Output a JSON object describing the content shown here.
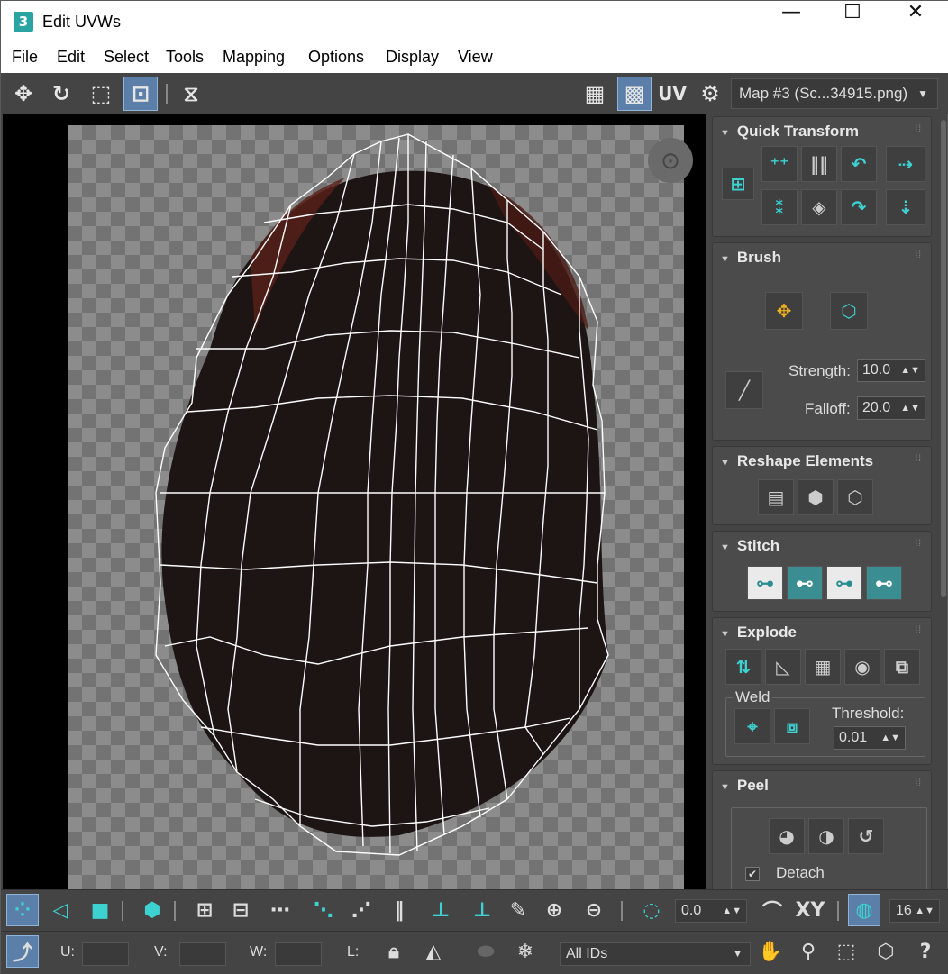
{
  "window": {
    "app_icon_text": "3",
    "title": "Edit UVWs",
    "minimize": "—",
    "maximize": "☐",
    "close": "✕"
  },
  "menu": [
    "File",
    "Edit",
    "Select",
    "Tools",
    "Mapping",
    "Options",
    "Display",
    "View"
  ],
  "toolbar": {
    "uv_label": "UV",
    "map_selector": "Map #3 (Sc...34915.png)"
  },
  "panels": {
    "quick_transform": {
      "title": "Quick Transform"
    },
    "brush": {
      "title": "Brush",
      "strength_label": "Strength:",
      "strength_value": "10.0",
      "falloff_label": "Falloff:",
      "falloff_value": "20.0"
    },
    "reshape": {
      "title": "Reshape Elements"
    },
    "stitch": {
      "title": "Stitch"
    },
    "explode": {
      "title": "Explode",
      "weld_label": "Weld",
      "threshold_label": "Threshold:",
      "threshold_value": "0.01"
    },
    "peel": {
      "title": "Peel",
      "detach_label": "Detach"
    }
  },
  "bottom": {
    "angle_value": "0.0",
    "xy_label": "XY",
    "snap_value": "16",
    "u_label": "U:",
    "v_label": "V:",
    "w_label": "W:",
    "l_label": "L:",
    "ids_value": "All IDs"
  },
  "colors": {
    "accent_teal": "#3ed1d1",
    "active_blue": "#5b7fa8",
    "panel_bg": "#444444"
  }
}
